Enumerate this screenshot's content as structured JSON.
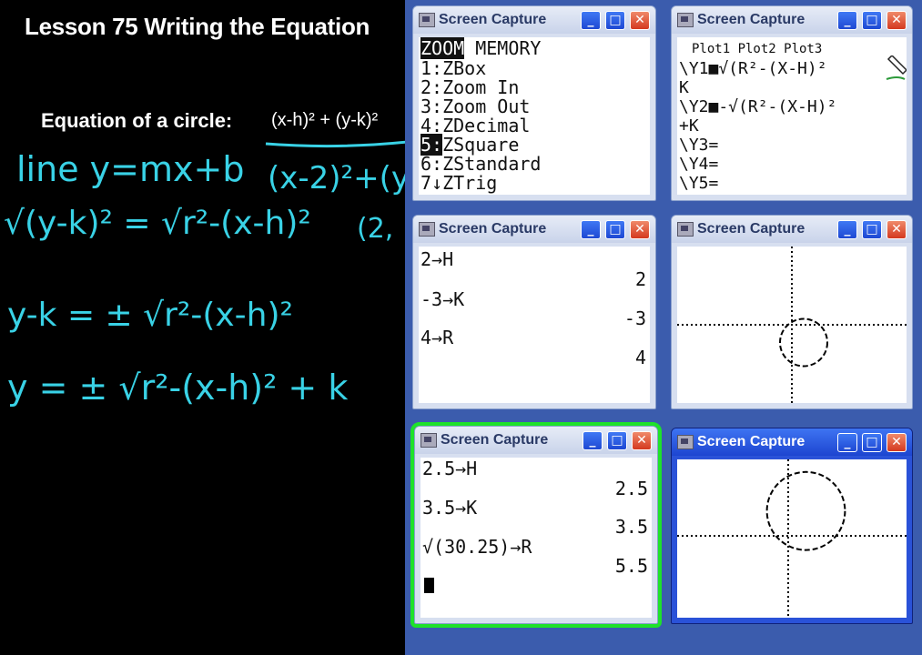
{
  "board": {
    "title": "Lesson 75  Writing the Equation",
    "eq_label": "Equation of a circle:",
    "eq_formula": "(x-h)² + (y-k)²",
    "handwriting": {
      "line_eq": "line y=mx+b",
      "sqrt_line": "√(y-k)² = √r²-(x-h)²",
      "yk": "y-k = ± √r²-(x-h)²",
      "y": "y = ± √r²-(x-h)² + k",
      "right_1": "(x-2)²+(y",
      "right_2": "(2,"
    }
  },
  "windows": {
    "title": "Screen Capture",
    "w1": {
      "lines": [
        "ZOOM MEMORY",
        "1:ZBox",
        "2:Zoom In",
        "3:Zoom Out",
        "4:ZDecimal",
        "5:ZSquare",
        "6:ZStandard",
        "7↓ZTrig"
      ]
    },
    "w2": {
      "plots": "Plot1 Plot2 Plot3",
      "lines": [
        "\\Y1■√(R²-(X-H)²",
        "K",
        "\\Y2■-√(R²-(X-H)²",
        "+K",
        "\\Y3=",
        "\\Y4=",
        "\\Y5="
      ]
    },
    "w3": {
      "lines": [
        "2→H",
        "2",
        "-3→K",
        "-3",
        "4→R",
        "4"
      ]
    },
    "w5": {
      "lines": [
        "2.5→H",
        "2.5",
        "3.5→K",
        "3.5",
        "√(30.25)→R",
        "5.5"
      ]
    },
    "graph1": {
      "h": 2,
      "k": -3,
      "r": 4
    },
    "graph2": {
      "h": 2.5,
      "k": 3.5,
      "r": 5.5
    }
  },
  "colors": {
    "desktop": "#3b5cad",
    "handwriting": "#39d2e6",
    "highlight": "#1ee22a",
    "active_title": "#2a52d8"
  }
}
